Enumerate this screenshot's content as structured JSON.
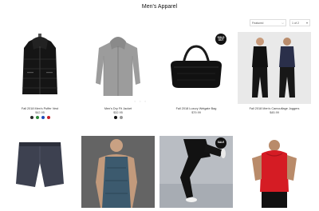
{
  "page": {
    "title": "Men's Apparel"
  },
  "controls": {
    "sort_value": "Featured",
    "page_value": "1 of 2"
  },
  "badges": {
    "sold_out": "SOLD OUT",
    "sale": "SALE"
  },
  "products": [
    {
      "name": "Fall 2018 Men's Puffer Vest",
      "price": "$42.95",
      "swatches": [
        "#2a2a2a",
        "#2e8b3a",
        "#1f4bb8",
        "#c8202a"
      ]
    },
    {
      "name": "Men's Dry Fit Jacket",
      "price": "$32.95",
      "swatches": [
        "#111111",
        "#999999"
      ]
    },
    {
      "name": "Fall 2018 Luxury Weigate Bag",
      "price": "$79.99"
    },
    {
      "name": "Fall 2018 Men's Camouflage Joggers",
      "price": "$45.99"
    },
    {
      "name": ""
    },
    {
      "name": ""
    },
    {
      "name": ""
    },
    {
      "name": ""
    }
  ]
}
